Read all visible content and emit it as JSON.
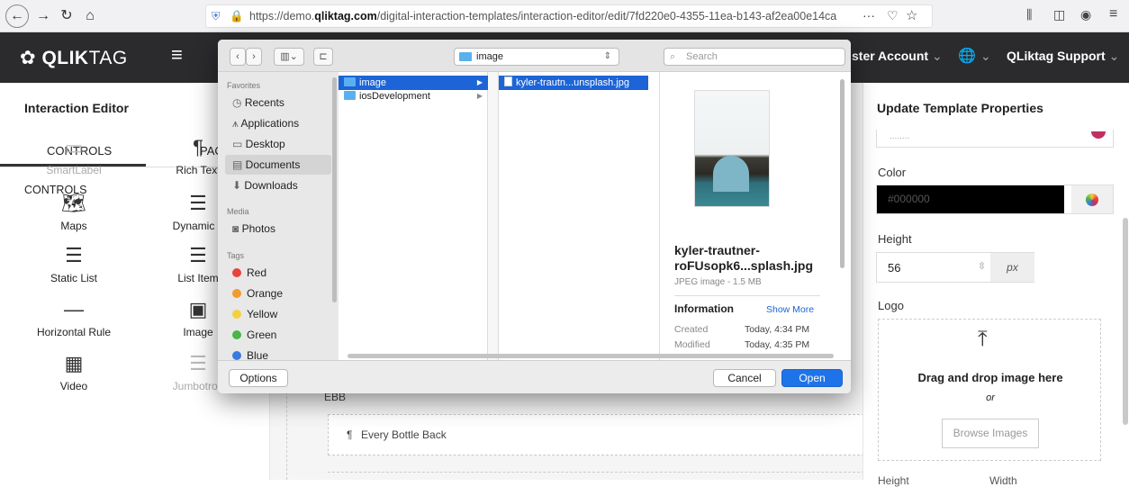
{
  "browser": {
    "url_prefix": "https://demo.",
    "url_domain": "qliktag.com",
    "url_rest": "/digital-interaction-templates/interaction-editor/edit/7fd220e0-4355-11ea-b143-af2ea00e14ca",
    "more": "···"
  },
  "navbar": {
    "logo_bold": "QLIK",
    "logo_light": "TAG",
    "account": "ster Account",
    "support": "QLiktag Support"
  },
  "left": {
    "title": "Interaction Editor",
    "tab_controls": "CONTROLS",
    "tab_pages": "PAC",
    "heading": "CONTROLS",
    "controls": [
      {
        "label": "SmartLabel",
        "icon": "smartlabel-icon",
        "glyph": "▭",
        "faded": true
      },
      {
        "label": "Rich Text",
        "icon": "paragraph-icon",
        "glyph": "¶",
        "faded": false
      },
      {
        "label": "Maps",
        "icon": "map-icon",
        "glyph": "🗺",
        "faded": false
      },
      {
        "label": "Dynamic L",
        "icon": "dynamic-list-icon",
        "glyph": "☰",
        "faded": false
      },
      {
        "label": "Static List",
        "icon": "static-list-icon",
        "glyph": "☰",
        "faded": false
      },
      {
        "label": "List Item",
        "icon": "list-item-icon",
        "glyph": "☰",
        "faded": false
      },
      {
        "label": "Horizontal Rule",
        "icon": "horizontal-rule-icon",
        "glyph": "—",
        "faded": false
      },
      {
        "label": "Image",
        "icon": "image-icon",
        "glyph": "▣",
        "faded": false
      },
      {
        "label": "Video",
        "icon": "video-icon",
        "glyph": "▦",
        "faded": false
      },
      {
        "label": "Jumbotron",
        "icon": "jumbotron-icon",
        "glyph": "☰",
        "faded": true
      }
    ]
  },
  "canvas": {
    "ebb": "EBB",
    "every_bottle": "Every Bottle Back"
  },
  "right": {
    "title": "Update Template Properties",
    "color_label": "Color",
    "color_value": "#000000",
    "height_label": "Height",
    "height_value": "56",
    "height_unit": "px",
    "logo_label": "Logo",
    "drop_text": "Drag and drop image here",
    "or": "or",
    "browse": "Browse Images",
    "height2": "Height",
    "width": "Width"
  },
  "dialog": {
    "path": "image",
    "search_placeholder": "Search",
    "fav_head": "Favorites",
    "favorites": [
      "Recents",
      "Applications",
      "Desktop",
      "Documents",
      "Downloads"
    ],
    "media_head": "Media",
    "media": [
      "Photos"
    ],
    "tags_head": "Tags",
    "tags": [
      {
        "name": "Red",
        "color": "#e8443a"
      },
      {
        "name": "Orange",
        "color": "#f29b30"
      },
      {
        "name": "Yellow",
        "color": "#f4d03f"
      },
      {
        "name": "Green",
        "color": "#48b648"
      },
      {
        "name": "Blue",
        "color": "#3a7be0"
      }
    ],
    "col1": [
      "image",
      "iosDevelopment"
    ],
    "col2": [
      "kyler-trautn...unsplash.jpg"
    ],
    "preview": {
      "name": "kyler-trautner-roFUsopk6...splash.jpg",
      "kind": "JPEG image - 1.5 MB",
      "info": "Information",
      "show_more": "Show More",
      "created_label": "Created",
      "created": "Today, 4:34 PM",
      "modified_label": "Modified",
      "modified": "Today, 4:35 PM"
    },
    "options": "Options",
    "cancel": "Cancel",
    "open": "Open"
  }
}
